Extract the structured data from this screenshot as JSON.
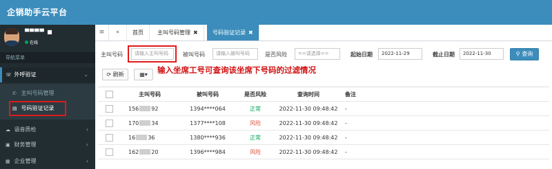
{
  "header": {
    "brand": "企销助手云平台"
  },
  "user": {
    "name": "▀▀▀▀ ■",
    "status": "在线"
  },
  "sidebar": {
    "nav_header": "导航菜单",
    "menu": [
      {
        "label": "外呼验证",
        "icon": "phone-menu-icon"
      },
      {
        "label": "语音质检",
        "icon": "cloud-icon"
      },
      {
        "label": "财务管理",
        "icon": "money-icon"
      },
      {
        "label": "企业管理",
        "icon": "building-icon"
      }
    ],
    "submenu": [
      {
        "label": "主叫号码管理",
        "icon": "phone-icon"
      },
      {
        "label": "号码验证记录",
        "icon": "record-icon"
      }
    ]
  },
  "tabs": {
    "home": "首页",
    "items": [
      {
        "label": "主叫号码管理",
        "close": "✖"
      },
      {
        "label": "号码验证记录",
        "close": "✖"
      }
    ]
  },
  "filters": {
    "caller_label": "主叫号码",
    "caller_placeholder": "请输入主叫号码",
    "callee_label": "被叫号码",
    "callee_placeholder": "请输入被叫号码",
    "risk_label": "是否风险",
    "risk_selected": "==请选择==",
    "start_label": "起始日期",
    "start_value": "2022-11-29",
    "end_label": "截止日期",
    "end_value": "2022-11-30",
    "search_label": "查询"
  },
  "toolbar": {
    "refresh_label": "刷新"
  },
  "annotation": "输入坐席工号可查询该坐席下号码的过滤情况",
  "table": {
    "headers": [
      "主叫号码",
      "被叫号码",
      "是否风险",
      "查询时间",
      "备注"
    ],
    "rows": [
      {
        "caller_prefix": "156",
        "caller_suffix": "92",
        "callee": "1394****064",
        "risk": "正常",
        "risk_ok": true,
        "time": "2022-11-30 09:48:42",
        "note": "-"
      },
      {
        "caller_prefix": "170",
        "caller_suffix": "34",
        "callee": "1377****108",
        "risk": "风险",
        "risk_ok": false,
        "time": "2022-11-30 09:48:42",
        "note": "-"
      },
      {
        "caller_prefix": "16",
        "caller_suffix": "36",
        "callee": "1380****936",
        "risk": "正常",
        "risk_ok": true,
        "time": "2022-11-30 09:48:42",
        "note": "-"
      },
      {
        "caller_prefix": "162",
        "caller_suffix": "20",
        "callee": "1396****984",
        "risk": "风险",
        "risk_ok": false,
        "time": "2022-11-30 09:48:42",
        "note": "-"
      }
    ]
  },
  "colors": {
    "primary": "#3c8dbc",
    "sidebar": "#222d32",
    "ok": "#00a65a",
    "risk": "#dd4b39",
    "highlight": "#e01a1a"
  }
}
